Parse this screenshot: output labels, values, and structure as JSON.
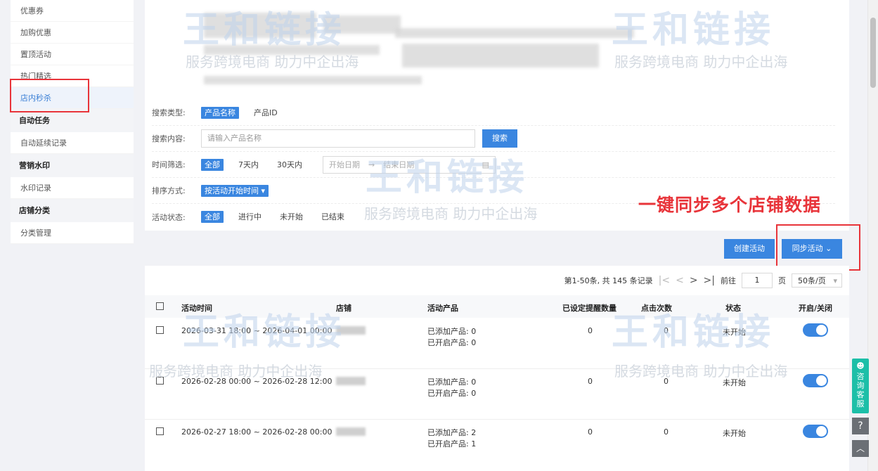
{
  "sidebar": {
    "items_top": [
      "优惠券",
      "加购优惠",
      "置顶活动",
      "热门精选",
      "店内秒杀"
    ],
    "groups": [
      {
        "title": "自动任务",
        "items": [
          "自动延续记录"
        ]
      },
      {
        "title": "营销水印",
        "items": [
          "水印记录"
        ]
      },
      {
        "title": "店铺分类",
        "items": [
          "分类管理"
        ]
      }
    ]
  },
  "filters": {
    "search_type_label": "搜索类型:",
    "search_type_options": [
      "产品名称",
      "产品ID"
    ],
    "search_content_label": "搜索内容:",
    "search_placeholder": "请输入产品名称",
    "search_button": "搜索",
    "time_label": "时间筛选:",
    "time_options": [
      "全部",
      "7天内",
      "30天内"
    ],
    "date_start": "开始日期",
    "date_sep": "→",
    "date_end": "结束日期",
    "sort_label": "排序方式:",
    "sort_value": "按活动开始时间",
    "status_label": "活动状态:",
    "status_options": [
      "全部",
      "进行中",
      "未开始",
      "已结束"
    ]
  },
  "annotation": "一键同步多个店铺数据",
  "actions": {
    "create": "创建活动",
    "sync": "同步活动 ⌄"
  },
  "pager": {
    "summary": "第1-50条, 共 145 条记录",
    "goto_label": "前往",
    "page": "1",
    "page_unit": "页",
    "page_size": "50条/页"
  },
  "table": {
    "headers": [
      "活动时间",
      "店铺",
      "活动产品",
      "已设定提醒数量",
      "点击次数",
      "状态",
      "开启/关闭"
    ],
    "rows": [
      {
        "time": "2026-03-31 18:00 ~ 2026-04-01 00:00",
        "added": "已添加产品: 0",
        "enabled": "已开启产品: 0",
        "reminders": "0",
        "clicks": "0",
        "status": "未开始"
      },
      {
        "time": "2026-02-28 00:00 ~ 2026-02-28 12:00",
        "added": "已添加产品: 0",
        "enabled": "已开启产品: 0",
        "reminders": "0",
        "clicks": "0",
        "status": "未开始"
      },
      {
        "time": "2026-02-27 18:00 ~ 2026-02-28 00:00",
        "added": "已添加产品: 2",
        "enabled": "已开启产品: 1",
        "reminders": "0",
        "clicks": "0",
        "status": "未开始"
      }
    ]
  },
  "watermark": {
    "brand": "王和链接",
    "slogan": "服务跨境电商 助力中企出海"
  },
  "float": {
    "consult": "咨询客服",
    "help": "?",
    "top": "︿"
  }
}
